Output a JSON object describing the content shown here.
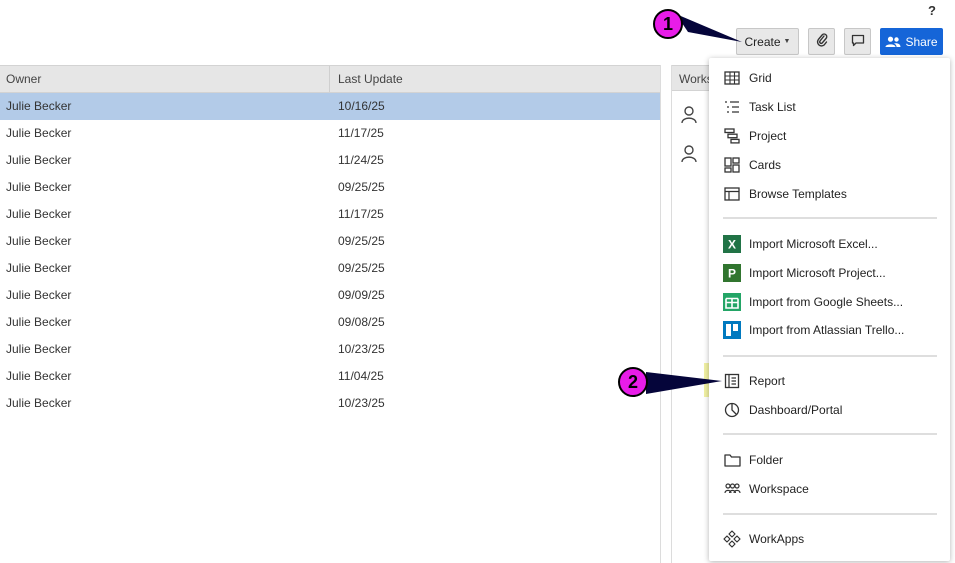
{
  "help": "?",
  "toolbar": {
    "create_label": "Create",
    "share_label": "Share",
    "colors": {
      "share_bg": "#1565d8",
      "create_bg": "#e8e8e8"
    }
  },
  "table": {
    "headers": [
      "Owner",
      "Last Update"
    ],
    "rows": [
      [
        "Julie Becker",
        "10/16/25"
      ],
      [
        "Julie Becker",
        "11/17/25"
      ],
      [
        "Julie Becker",
        "11/24/25"
      ],
      [
        "Julie Becker",
        "09/25/25"
      ],
      [
        "Julie Becker",
        "11/17/25"
      ],
      [
        "Julie Becker",
        "09/25/25"
      ],
      [
        "Julie Becker",
        "09/25/25"
      ],
      [
        "Julie Becker",
        "09/09/25"
      ],
      [
        "Julie Becker",
        "09/08/25"
      ],
      [
        "Julie Becker",
        "10/23/25"
      ],
      [
        "Julie Becker",
        "11/04/25"
      ],
      [
        "Julie Becker",
        "10/23/25"
      ]
    ],
    "selected_row": 0
  },
  "panel": {
    "header": "Works"
  },
  "menu": {
    "group1": [
      {
        "label": "Grid",
        "icon": "grid-icon"
      },
      {
        "label": "Task List",
        "icon": "task-list-icon"
      },
      {
        "label": "Project",
        "icon": "project-icon"
      },
      {
        "label": "Cards",
        "icon": "cards-icon"
      },
      {
        "label": "Browse Templates",
        "icon": "templates-icon"
      }
    ],
    "group2": [
      {
        "label": "Import Microsoft Excel...",
        "icon": "excel-icon",
        "color": "#217346"
      },
      {
        "label": "Import Microsoft Project...",
        "icon": "ms-project-icon",
        "color": "#31752f"
      },
      {
        "label": "Import from Google Sheets...",
        "icon": "google-sheets-icon",
        "color": "#23a566"
      },
      {
        "label": "Import from Atlassian Trello...",
        "icon": "trello-icon",
        "color": "#0079bf"
      }
    ],
    "group3": [
      {
        "label": "Report",
        "icon": "report-icon",
        "highlighted": true
      },
      {
        "label": "Dashboard/Portal",
        "icon": "dashboard-icon"
      }
    ],
    "group4": [
      {
        "label": "Folder",
        "icon": "folder-icon"
      },
      {
        "label": "Workspace",
        "icon": "workspace-icon"
      }
    ],
    "group5": [
      {
        "label": "WorkApps",
        "icon": "workapps-icon"
      }
    ]
  },
  "callouts": {
    "first": "1",
    "second": "2",
    "color": "#e81ce8"
  }
}
